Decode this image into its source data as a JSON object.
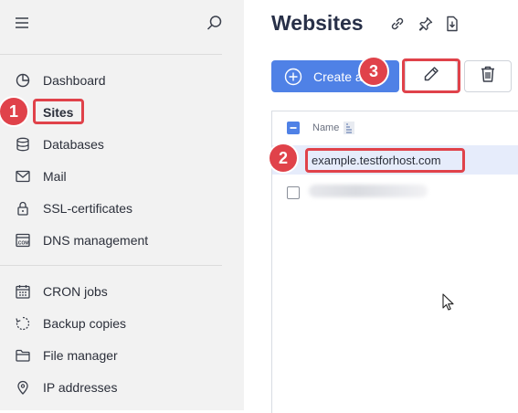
{
  "sidebar": {
    "items": [
      {
        "label": "Dashboard",
        "icon": "dashboard-pie-icon"
      },
      {
        "label": "Sites",
        "icon": "sites-icon",
        "active": true
      },
      {
        "label": "Databases",
        "icon": "database-icon"
      },
      {
        "label": "Mail",
        "icon": "mail-icon"
      },
      {
        "label": "SSL-certificates",
        "icon": "lock-icon"
      },
      {
        "label": "DNS management",
        "icon": "dns-com-icon"
      },
      {
        "label": "CRON jobs",
        "icon": "calendar-icon"
      },
      {
        "label": "Backup copies",
        "icon": "backup-icon"
      },
      {
        "label": "File manager",
        "icon": "folder-icon"
      },
      {
        "label": "IP addresses",
        "icon": "location-pin-icon"
      }
    ]
  },
  "main": {
    "title": "Websites",
    "create_label": "Create a",
    "table": {
      "name_header": "Name",
      "rows": [
        {
          "domain": "example.testforhost.com",
          "selected": true
        },
        {
          "domain": "",
          "selected": false
        }
      ]
    }
  },
  "annotations": {
    "step1": "1",
    "step2": "2",
    "step3": "3",
    "color": "#e0424a"
  },
  "colors": {
    "accent": "#4f81e6",
    "sidebar_bg": "#f2f2f2",
    "selected_row": "#e6ecfb",
    "title": "#283048"
  }
}
